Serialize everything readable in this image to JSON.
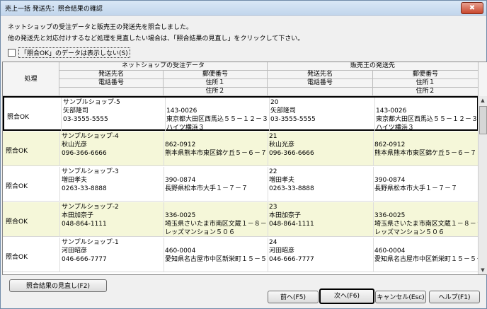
{
  "window": {
    "title": "売上一括 発送先：照合結果の確認",
    "close": "✖"
  },
  "messages": {
    "line1": "ネットショップの受注データと販売王の発送先を照合しました。",
    "line2": "他の発送先と対応付けするなど処理を見直したい場合は、「照合結果の見直し」をクリックして下さい。"
  },
  "checkbox": {
    "label": "「照合OK」のデータは表示しない(S)",
    "checked": false
  },
  "grid": {
    "headers": {
      "action": "処理",
      "netshop_group": "ネットショップの受注データ",
      "hanbai_group": "販売王の発送先",
      "dest_name": "発送先名",
      "postal": "郵便番号",
      "phone": "電話番号",
      "addr1": "住所１",
      "addr2": "住所２"
    },
    "rows": [
      {
        "status": "照合OK",
        "n_name": "サンプルショップ-5",
        "n_person": "矢部隆司",
        "n_phone": "03-3555-5555",
        "n_zip": "143-0026",
        "n_addr1": "東京都大田区西馬込５５－１２－３",
        "n_addr2": "ハイツ横浜３",
        "h_code": "20",
        "h_person": "矢部隆司",
        "h_phone": "03-3555-5555",
        "h_zip": "143-0026",
        "h_addr1": "東京都大田区西馬込５５－１２－３",
        "h_addr2": "ハイツ横浜３"
      },
      {
        "status": "照合OK",
        "n_name": "サンプルショップ-4",
        "n_person": "秋山光彦",
        "n_phone": "096-366-6666",
        "n_zip": "862-0912",
        "n_addr1": "熊本県熊本市東区錦ケ丘５－６－７",
        "n_addr2": "",
        "h_code": "21",
        "h_person": "秋山光彦",
        "h_phone": "096-366-6666",
        "h_zip": "862-0912",
        "h_addr1": "熊本県熊本市東区錦ケ丘５－６－７",
        "h_addr2": ""
      },
      {
        "status": "照合OK",
        "n_name": "サンプルショップ-3",
        "n_person": "増田孝夫",
        "n_phone": "0263-33-8888",
        "n_zip": "390-0874",
        "n_addr1": "長野県松本市大手１－７－７",
        "n_addr2": "",
        "h_code": "22",
        "h_person": "増田孝夫",
        "h_phone": "0263-33-8888",
        "h_zip": "390-0874",
        "h_addr1": "長野県松本市大手１－７－７",
        "h_addr2": ""
      },
      {
        "status": "照合OK",
        "n_name": "サンプルショップ-2",
        "n_person": "本田加奈子",
        "n_phone": "048-864-1111",
        "n_zip": "336-0025",
        "n_addr1": "埼玉県さいたま市南区文蔵１－８－",
        "n_addr2": "レッズマンション５０６",
        "h_code": "23",
        "h_person": "本田加奈子",
        "h_phone": "048-864-1111",
        "h_zip": "336-0025",
        "h_addr1": "埼玉県さいたま市南区文蔵１－８－９",
        "h_addr2": "レッズマンション５０６"
      },
      {
        "status": "照合OK",
        "n_name": "サンプルショップ-1",
        "n_person": "河田昭彦",
        "n_phone": "046-666-7777",
        "n_zip": "460-0004",
        "n_addr1": "愛知県名古屋市中区新栄町１５－５",
        "n_addr2": "",
        "h_code": "24",
        "h_person": "河田昭彦",
        "h_phone": "046-666-7777",
        "h_zip": "460-0004",
        "h_addr1": "愛知県名古屋市中区新栄町１５－５－",
        "h_addr2": ""
      }
    ]
  },
  "buttons": {
    "review": "照合結果の見直し(F2)",
    "prev": "前へ(F5)",
    "next": "次へ(F6)",
    "cancel": "キャンセル(Esc)",
    "help": "ヘルプ(F1)"
  }
}
